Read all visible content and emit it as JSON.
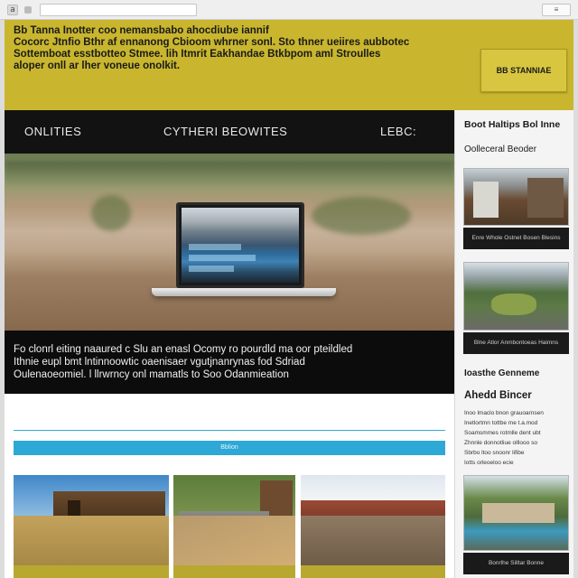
{
  "browser": {
    "tab_glyph": "a",
    "right_tab_label": "≡"
  },
  "banner": {
    "lines": [
      "Bb Tanna Inotter coo  nemansbabo  ahocdiube iannif",
      "Cocorc Jtnfio Bthr af ennanong Cbioom whrner sonl. Sto thner ueiires aubbotec",
      "Sottemboat esstbotteo Stmee. lih Itmrit  Eakhandae Btkbpom aml Stroulles",
      "aloper onll ar lher  voneue                                          onolkit."
    ],
    "cta_label": "BB STANNIAE"
  },
  "nav": {
    "items": [
      "ONLITIES",
      "CYTHERI BEOWITES",
      "LEBC:"
    ]
  },
  "hero_caption": {
    "lines": [
      "Fo clonrl eiting naaured c Slu an enasl Ocomy ro pourdld ma oor pteildled",
      "Ithnie eupl bmt lntinnoowtic oaenisaer vgutjnanrynas fod Sdriad",
      "Oulenaoeomiel.  l llrwrncy onl mamatls to Soo Odanmieation"
    ]
  },
  "action_bar": {
    "label": "Bblion"
  },
  "sidebar": {
    "title_1": "Boot Haltips Bol Inne",
    "title_2": "Oolleceral Beoder",
    "photo_1_caption": "Enre Whole Ostnet Bosen Blesins",
    "photo_2_caption": "Blne Atlor Anmbontoeas Haimns",
    "title_3": "Ioasthe Genneme",
    "title_4": "Ahedd Bincer",
    "text_lines": [
      "Inoo lmaclo bnon grauoarnsen",
      "Inetlortmn tottbe me t.a.mod",
      "Soamsmmes rotmlle dent ubt",
      "Zhnnle donnotliue olllooo so",
      "Sbrbo ltoo snoonr lifibe",
      "Iotts orleoeloo ecie"
    ],
    "photo_3_caption": "Bonrlhe Silltar Bonne"
  },
  "colors": {
    "banner_yellow": "#c9b62e",
    "nav_black": "#121212",
    "accent_blue": "#2ea8d6",
    "sidebar_bg": "#f4f4f4"
  }
}
